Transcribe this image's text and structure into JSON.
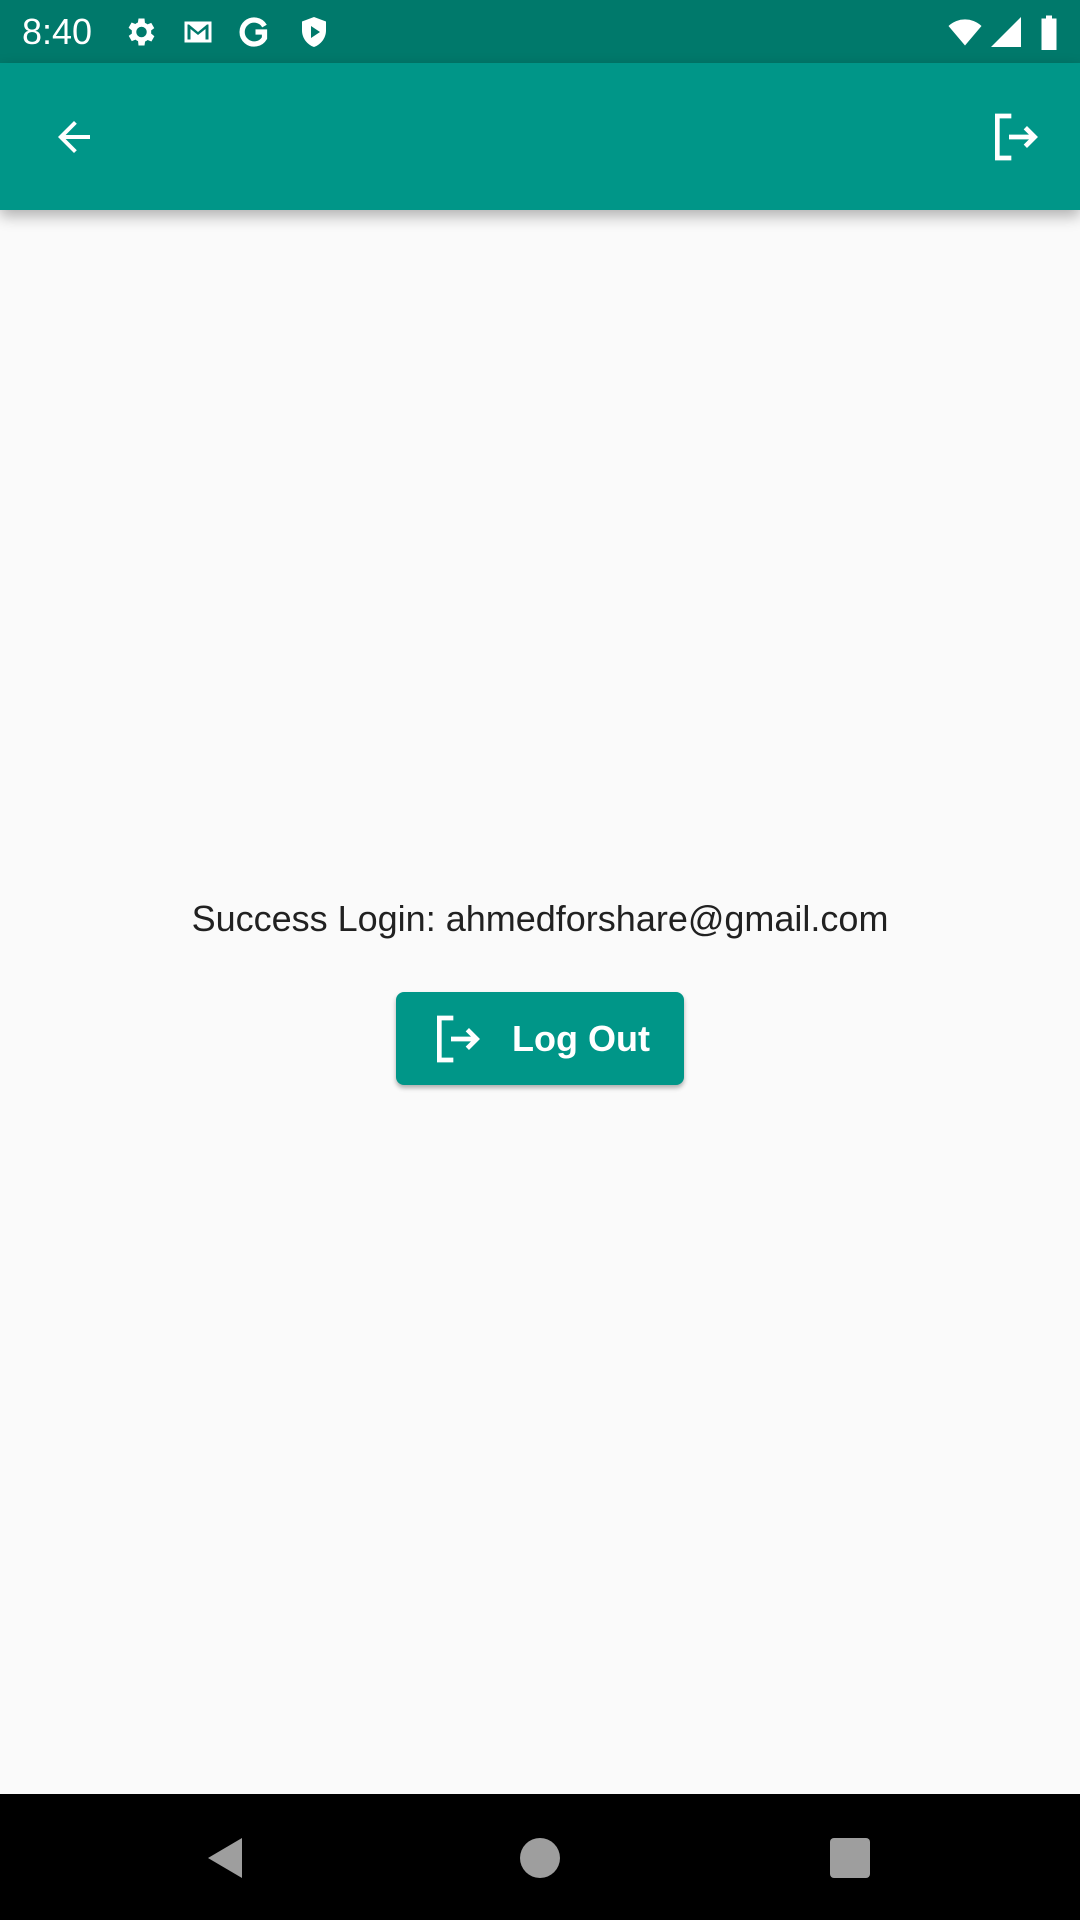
{
  "status_bar": {
    "time": "8:40",
    "icons": [
      "settings-icon",
      "gmail-icon",
      "google-icon",
      "play-protect-icon",
      "wifi-icon",
      "signal-icon",
      "battery-icon"
    ]
  },
  "app_bar": {
    "back_icon": "arrow-back-icon",
    "action_icon": "logout-icon"
  },
  "main": {
    "message": "Success Login: ahmedforshare@gmail.com",
    "logout_label": "Log Out"
  },
  "colors": {
    "primary": "#009688",
    "primary_dark": "#00796b",
    "background": "#fafafa"
  }
}
